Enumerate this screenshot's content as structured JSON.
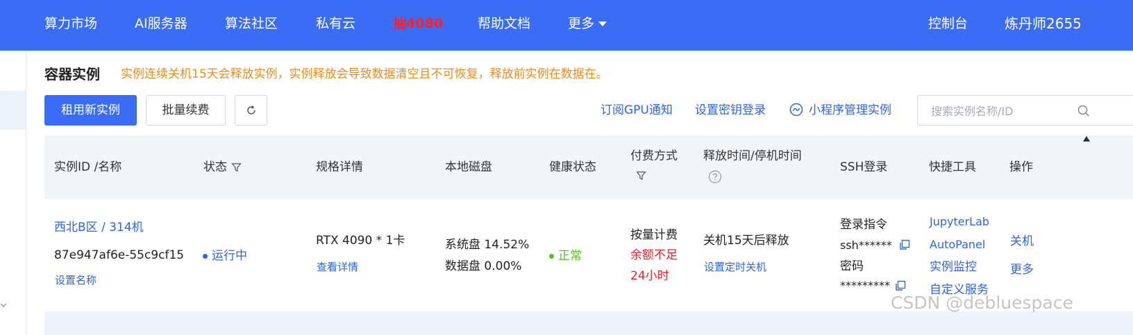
{
  "nav": {
    "items": [
      "算力市场",
      "AI服务器",
      "算法社区",
      "私有云",
      "抽4080",
      "帮助文档",
      "更多"
    ],
    "console": "控制台",
    "user": "炼丹师2655"
  },
  "page": {
    "title": "容器实例",
    "notice": "实例连续关机15天会释放实例，实例释放会导致数据清空且不可恢复，释放前实例在数据在。"
  },
  "toolbar": {
    "rent_button": "租用新实例",
    "renew_button": "批量续费",
    "links": [
      "订阅GPU通知",
      "设置密钥登录",
      "小程序管理实例"
    ],
    "search_placeholder": "搜索实例名称/ID"
  },
  "table": {
    "headers": {
      "instance": "实例ID /名称",
      "status": "状态",
      "spec": "规格详情",
      "disk": "本地磁盘",
      "health": "健康状态",
      "billing": "付费方式",
      "release": "释放时间/停机时间",
      "ssh": "SSH登录",
      "tools": "快捷工具",
      "actions": "操作"
    },
    "rows": [
      {
        "region": "西北B区 / 314机",
        "id": "87e947af6e-55c9cf15",
        "set_name": "设置名称",
        "status": "运行中",
        "spec": "RTX 4090 * 1卡",
        "spec_detail": "查看详情",
        "system_disk": "系统盘 14.52%",
        "data_disk": "数据盘 0.00%",
        "health": "正常",
        "billing": "按量计费",
        "billing_warn_1": "余额不足",
        "billing_warn_2": "24小时",
        "release": "关机15天后释放",
        "schedule": "设置定时关机",
        "ssh_cmd_label": "登录指令",
        "ssh_cmd": "ssh******",
        "ssh_pwd_label": "密码",
        "ssh_pwd": "*********",
        "tools": [
          "JupyterLab",
          "AutoPanel",
          "实例监控",
          "自定义服务"
        ],
        "actions": [
          "关机",
          "更多"
        ]
      }
    ]
  },
  "watermark": "CSDN @debluespace",
  "colors": {
    "brand": "#3b6cf6",
    "link": "#2f64e6",
    "warning": "#f08b1a",
    "danger": "#f5222d",
    "success": "#52c41a",
    "promo": "#ff1f1f"
  }
}
